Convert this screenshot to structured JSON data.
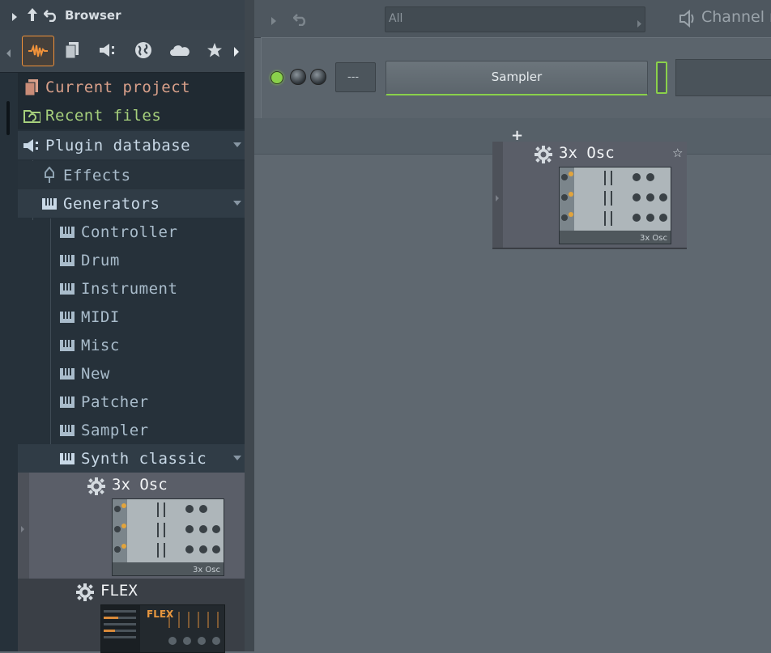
{
  "browser": {
    "title": "Browser",
    "toolbar_icons": [
      "waveform-icon",
      "document-icon",
      "speaker-icon",
      "globe-icon",
      "cloud-icon",
      "star-icon"
    ],
    "tree": [
      {
        "label": "Current project",
        "icon": "project-icon",
        "color": "#d9a08a"
      },
      {
        "label": "Recent files",
        "icon": "recent-icon",
        "color": "#a6d07c"
      },
      {
        "label": "Plugin database",
        "icon": "plugin-icon",
        "color": "#c8d8e6"
      },
      {
        "label": "Effects",
        "icon": "effect-icon",
        "color": "#a9bccb"
      },
      {
        "label": "Generators",
        "icon": "piano-icon",
        "color": "#c8d8e6"
      },
      {
        "label": "Controller",
        "icon": "piano-icon",
        "color": "#a9bccb"
      },
      {
        "label": "Drum",
        "icon": "piano-icon",
        "color": "#a9bccb"
      },
      {
        "label": "Instrument",
        "icon": "piano-icon",
        "color": "#a9bccb"
      },
      {
        "label": "MIDI",
        "icon": "piano-icon",
        "color": "#a9bccb"
      },
      {
        "label": "Misc",
        "icon": "piano-icon",
        "color": "#a9bccb"
      },
      {
        "label": "New",
        "icon": "piano-icon",
        "color": "#a9bccb"
      },
      {
        "label": "Patcher",
        "icon": "piano-icon",
        "color": "#a9bccb"
      },
      {
        "label": "Sampler",
        "icon": "piano-icon",
        "color": "#a9bccb"
      },
      {
        "label": "Synth classic",
        "icon": "piano-icon",
        "color": "#c8d8e6"
      }
    ],
    "plugins": [
      {
        "label": "3x Osc",
        "icon": "gear-icon"
      },
      {
        "label": "FLEX",
        "icon": "gear-icon"
      }
    ]
  },
  "topbar": {
    "filter_value": "All",
    "channel_label": "Channel r"
  },
  "channel": {
    "display": "---",
    "sampler_label": "Sampler"
  },
  "drag_preview": {
    "plus": "+",
    "label": "3x Osc",
    "star": "☆"
  },
  "thumb_3xosc": {
    "brand": "3x Osc"
  },
  "thumb_flex": {
    "brand": "FLEX"
  },
  "colors": {
    "accent": "#f0923a",
    "green": "#8ad14b",
    "sidebar_bg": "#26313a"
  }
}
